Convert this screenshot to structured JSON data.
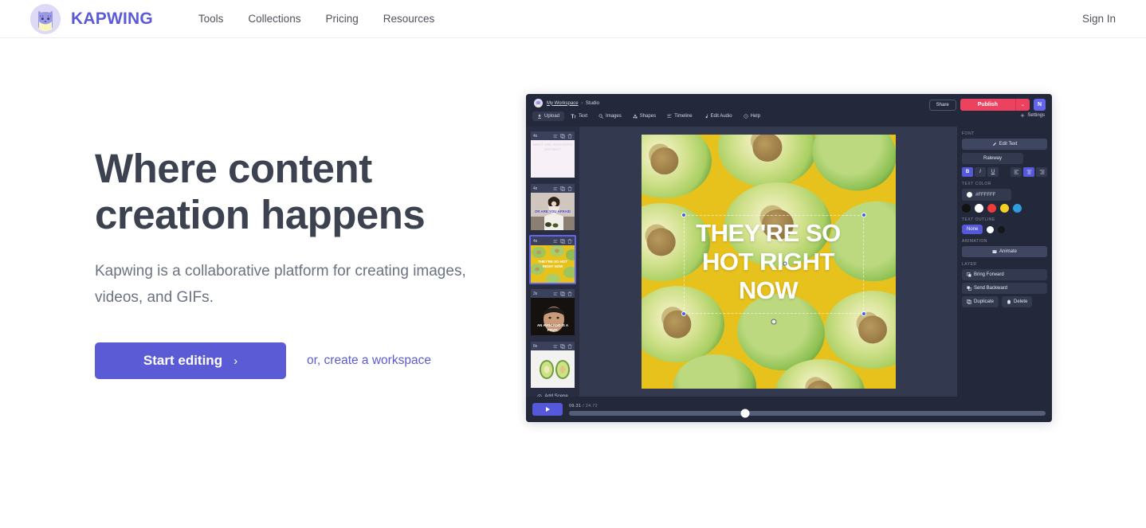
{
  "nav": {
    "brand": "KAPWING",
    "links": [
      "Tools",
      "Collections",
      "Pricing",
      "Resources"
    ],
    "signin": "Sign In"
  },
  "hero": {
    "title_line1": "Where content",
    "title_line2": "creation happens",
    "subtitle": "Kapwing is a collaborative platform for creating images, videos, and GIFs.",
    "cta_label": "Start editing",
    "cta_chevron": "›",
    "secondary_link": "or, create a workspace",
    "accent_color": "#5b5bd6",
    "title_color": "#3c4250"
  },
  "app": {
    "breadcrumb": {
      "workspace": "My Workspace",
      "separator": "›",
      "page": "Studio"
    },
    "toolbar": [
      {
        "label": "Upload",
        "icon": "upload-icon",
        "active": true
      },
      {
        "label": "Text",
        "icon": "text-icon",
        "active": false
      },
      {
        "label": "Images",
        "icon": "search-icon",
        "active": false
      },
      {
        "label": "Shapes",
        "icon": "shapes-icon",
        "active": false
      },
      {
        "label": "Timeline",
        "icon": "timeline-icon",
        "active": false
      },
      {
        "label": "Edit Audio",
        "icon": "audio-icon",
        "active": false
      },
      {
        "label": "Help",
        "icon": "help-icon",
        "active": false
      }
    ],
    "share_label": "Share",
    "publish_label": "Publish",
    "publish_caret": "⌄",
    "avatar_initial": "N",
    "settings_label": "Settings",
    "publish_color": "#ec4260",
    "scenes": [
      {
        "duration": "4s",
        "caption": "WHAT ARE AVOCADOS ANYWAY?",
        "selected": false,
        "style": "blank"
      },
      {
        "duration": "4s",
        "caption": "OR ARE YOU AFRAID",
        "selected": false,
        "style": "kitchen"
      },
      {
        "duration": "4s",
        "caption": "THEY'RE SO HOT RIGHT NOW",
        "selected": true,
        "style": "avocado-yellow"
      },
      {
        "duration": "3s",
        "caption": "AN AVOCADO IS A FRUIT.",
        "selected": false,
        "style": "portrait"
      },
      {
        "duration": "8s",
        "caption": "",
        "selected": false,
        "style": "avocado-pair"
      }
    ],
    "add_scene_label": "Add Scene",
    "canvas_text": "THEY'RE SO HOT RIGHT NOW",
    "properties": {
      "font_label": "FONT",
      "edit_text_label": "Edit Text",
      "font_name": "Raleway",
      "bold": "B",
      "italic": "I",
      "underline": "U",
      "align_left": "≡",
      "align_center": "≡",
      "align_right": "≡",
      "text_color_label": "TEXT COLOR",
      "text_color_value": "#FFFFFF",
      "swatches": [
        "#111111",
        "#ffffff",
        "#f03b3b",
        "#f2d024",
        "#309ce0"
      ],
      "text_outline_label": "TEXT OUTLINE",
      "outline_none": "None",
      "animation_label": "ANIMATION",
      "animate_label": "Animate",
      "layer_label": "LAYER",
      "bring_forward": "Bring Forward",
      "send_backward": "Send Backward",
      "duplicate": "Duplicate",
      "delete": "Delete"
    },
    "player": {
      "current_time": "09.31",
      "separator": "/",
      "total_time": "24.72",
      "progress_percent": 37
    }
  }
}
